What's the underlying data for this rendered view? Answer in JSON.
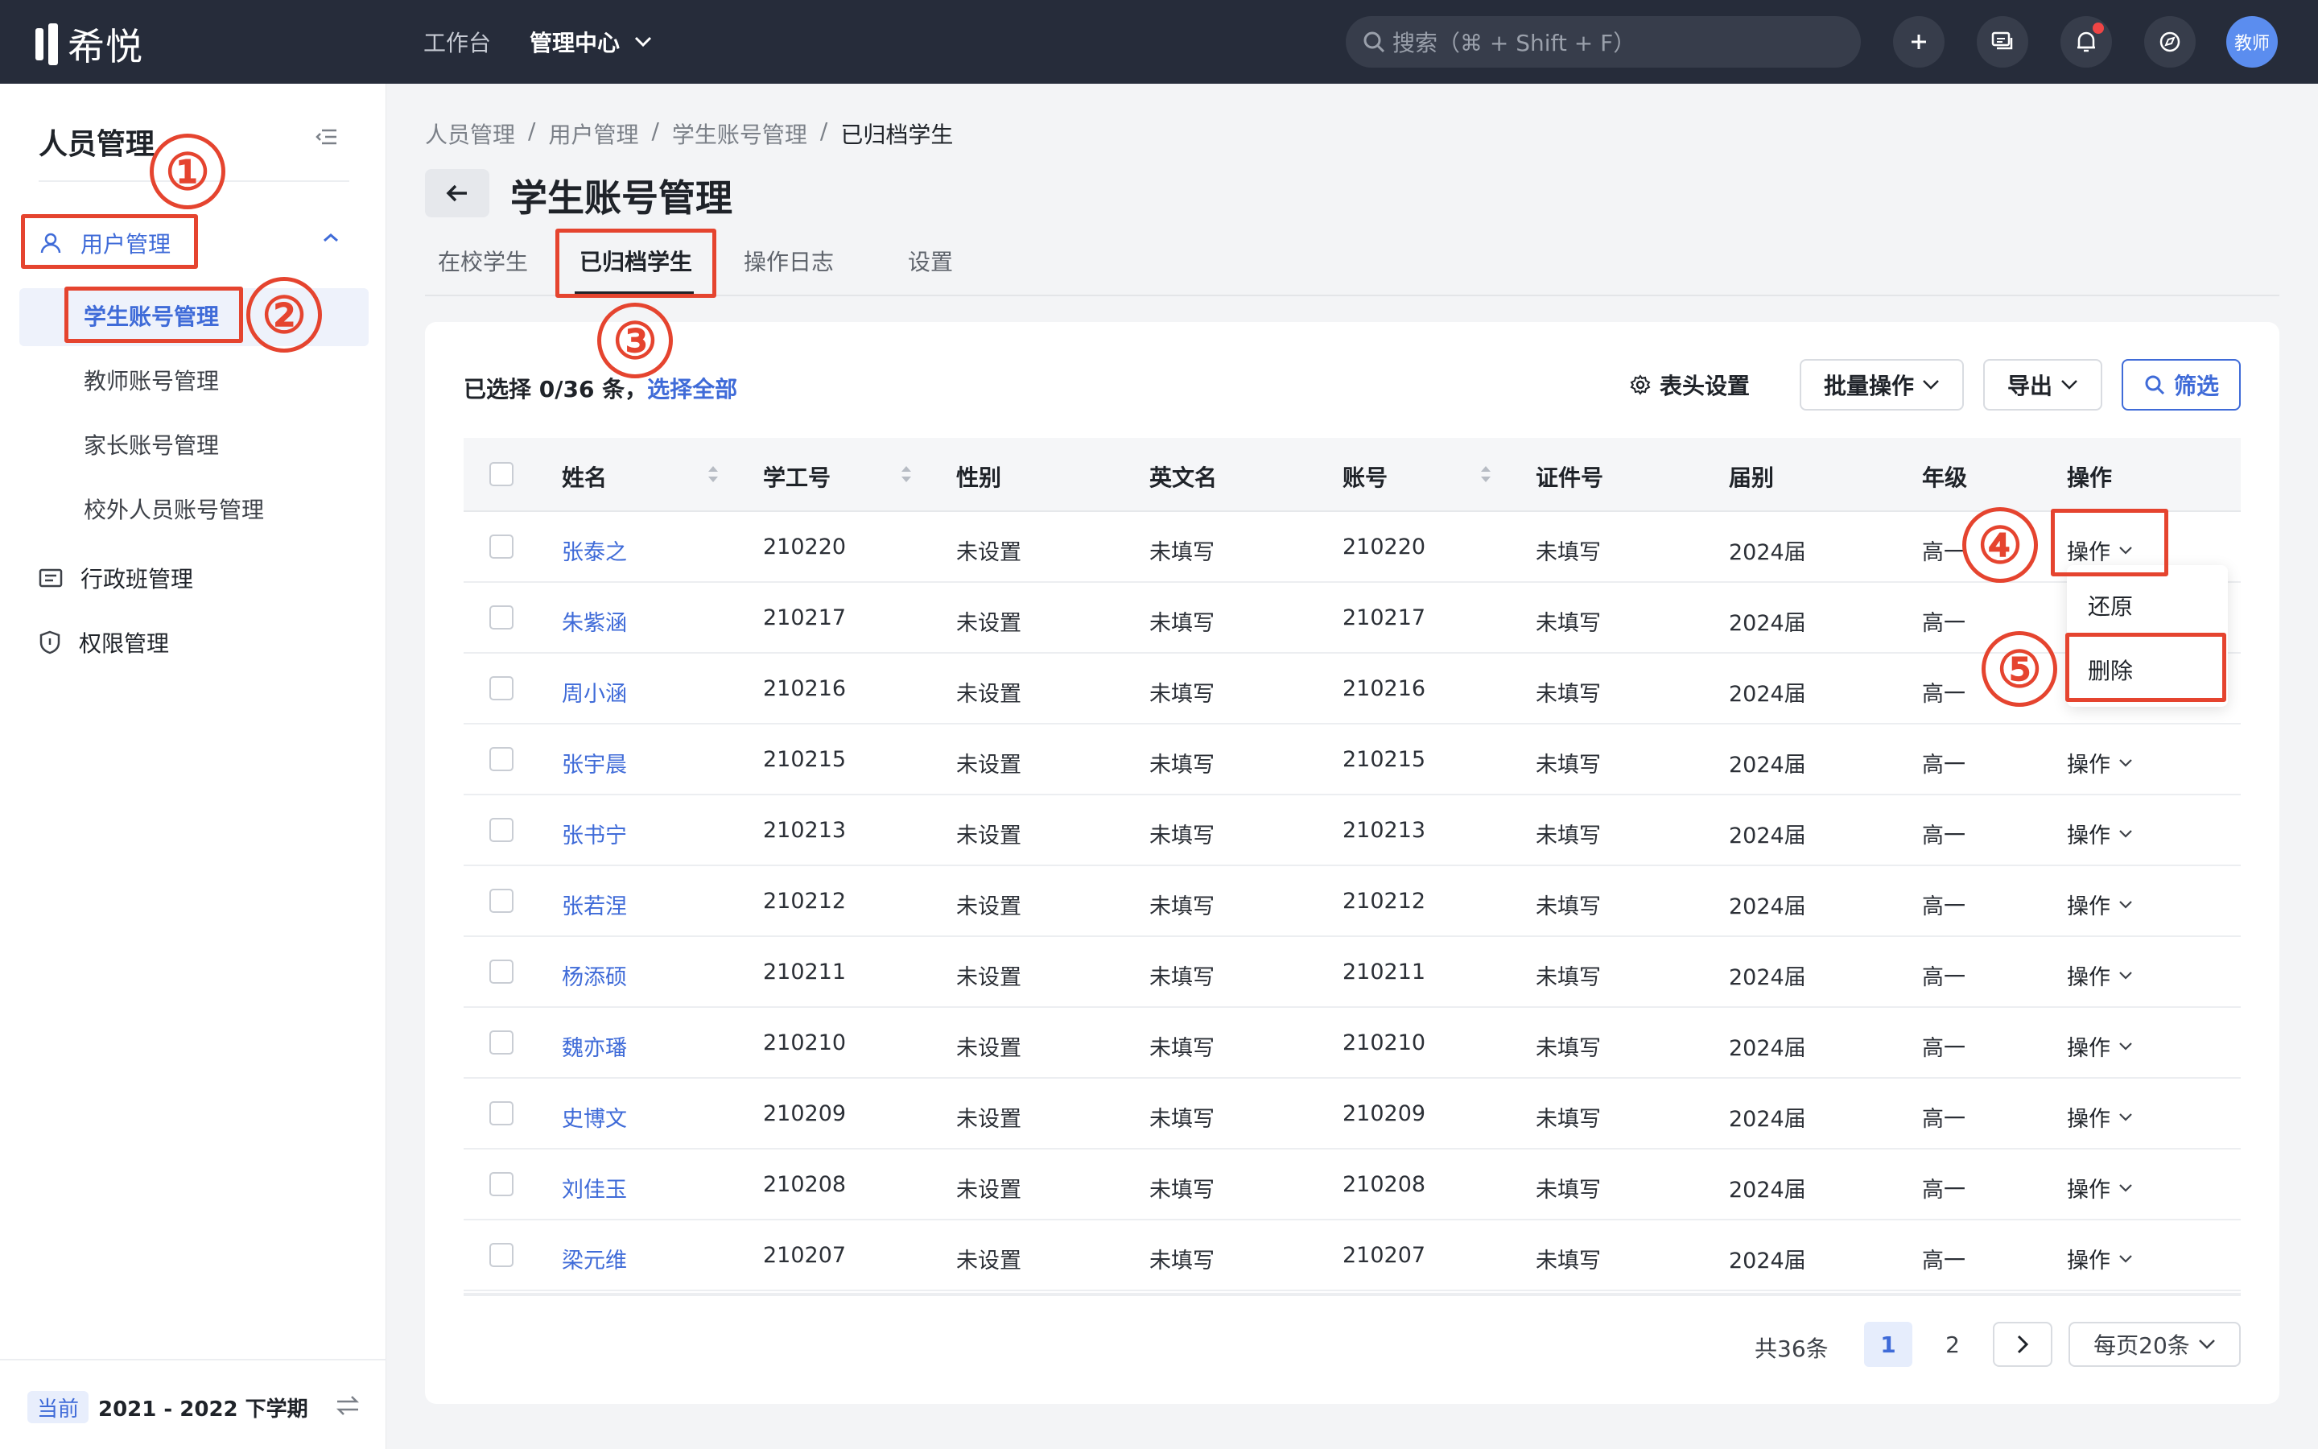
{
  "app": {
    "logo_text": "希悦"
  },
  "topnav": {
    "workbench": "工作台",
    "admin_center": "管理中心"
  },
  "search": {
    "placeholder": "搜索（⌘ + Shift + F）"
  },
  "user": {
    "avatar_text": "教师"
  },
  "sidebar": {
    "title": "人员管理",
    "groups": [
      {
        "label": "用户管理",
        "icon": "user-icon"
      },
      {
        "label": "行政班管理",
        "icon": "class-icon"
      },
      {
        "label": "权限管理",
        "icon": "shield-icon"
      }
    ],
    "items": [
      {
        "label": "学生账号管理"
      },
      {
        "label": "教师账号管理"
      },
      {
        "label": "家长账号管理"
      },
      {
        "label": "校外人员账号管理"
      }
    ],
    "term_badge": "当前",
    "term_text": "2021 - 2022 下学期"
  },
  "breadcrumb": [
    "人员管理",
    "用户管理",
    "学生账号管理",
    "已归档学生"
  ],
  "breadcrumb_sep": "/",
  "page_title": "学生账号管理",
  "tabs": [
    {
      "label": "在校学生"
    },
    {
      "label": "已归档学生"
    },
    {
      "label": "操作日志"
    },
    {
      "label": "设置"
    }
  ],
  "selection": {
    "text": "已选择 0/36 条，",
    "select_all": "选择全部"
  },
  "toolbar": {
    "header_settings": "表头设置",
    "batch": "批量操作",
    "export": "导出",
    "filter": "筛选"
  },
  "table": {
    "columns": [
      "姓名",
      "学工号",
      "性别",
      "英文名",
      "账号",
      "证件号",
      "届别",
      "年级",
      "操作"
    ],
    "rows": [
      {
        "name": "张泰之",
        "id": "210220",
        "gender": "未设置",
        "en": "未填写",
        "account": "210220",
        "cert": "未填写",
        "cohort": "2024届",
        "grade": "高一",
        "op": "操作"
      },
      {
        "name": "朱紫涵",
        "id": "210217",
        "gender": "未设置",
        "en": "未填写",
        "account": "210217",
        "cert": "未填写",
        "cohort": "2024届",
        "grade": "高一",
        "op": ""
      },
      {
        "name": "周小涵",
        "id": "210216",
        "gender": "未设置",
        "en": "未填写",
        "account": "210216",
        "cert": "未填写",
        "cohort": "2024届",
        "grade": "高一",
        "op": ""
      },
      {
        "name": "张宇晨",
        "id": "210215",
        "gender": "未设置",
        "en": "未填写",
        "account": "210215",
        "cert": "未填写",
        "cohort": "2024届",
        "grade": "高一",
        "op": "操作"
      },
      {
        "name": "张书宁",
        "id": "210213",
        "gender": "未设置",
        "en": "未填写",
        "account": "210213",
        "cert": "未填写",
        "cohort": "2024届",
        "grade": "高一",
        "op": "操作"
      },
      {
        "name": "张若涅",
        "id": "210212",
        "gender": "未设置",
        "en": "未填写",
        "account": "210212",
        "cert": "未填写",
        "cohort": "2024届",
        "grade": "高一",
        "op": "操作"
      },
      {
        "name": "杨添硕",
        "id": "210211",
        "gender": "未设置",
        "en": "未填写",
        "account": "210211",
        "cert": "未填写",
        "cohort": "2024届",
        "grade": "高一",
        "op": "操作"
      },
      {
        "name": "魏亦璠",
        "id": "210210",
        "gender": "未设置",
        "en": "未填写",
        "account": "210210",
        "cert": "未填写",
        "cohort": "2024届",
        "grade": "高一",
        "op": "操作"
      },
      {
        "name": "史博文",
        "id": "210209",
        "gender": "未设置",
        "en": "未填写",
        "account": "210209",
        "cert": "未填写",
        "cohort": "2024届",
        "grade": "高一",
        "op": "操作"
      },
      {
        "name": "刘佳玉",
        "id": "210208",
        "gender": "未设置",
        "en": "未填写",
        "account": "210208",
        "cert": "未填写",
        "cohort": "2024届",
        "grade": "高一",
        "op": "操作"
      },
      {
        "name": "梁元维",
        "id": "210207",
        "gender": "未设置",
        "en": "未填写",
        "account": "210207",
        "cert": "未填写",
        "cohort": "2024届",
        "grade": "高一",
        "op": "操作"
      }
    ]
  },
  "row_menu": {
    "restore": "还原",
    "delete": "删除"
  },
  "pagination": {
    "total": "共36条",
    "pages": [
      "1",
      "2"
    ],
    "current": "1",
    "page_size": "每页20条"
  },
  "annotations": [
    "①",
    "②",
    "③",
    "④",
    "⑤"
  ],
  "colors": {
    "accent": "#3f6bd8",
    "topbar": "#262c3a",
    "annotation": "#e5442f"
  }
}
